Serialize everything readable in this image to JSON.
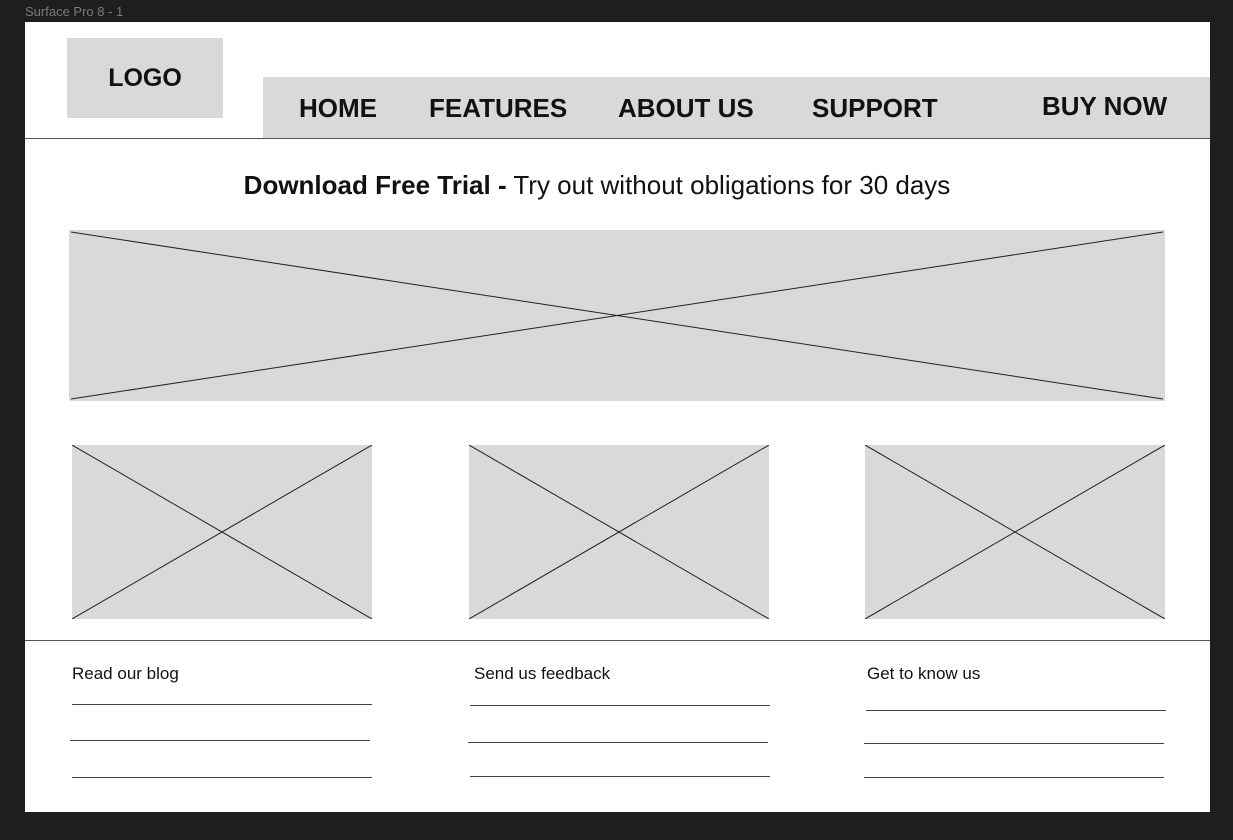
{
  "frame": {
    "label": "Surface Pro 8 - 1"
  },
  "header": {
    "logo_text": "LOGO",
    "nav": {
      "home": "HOME",
      "features": "FEATURES",
      "about_us": "ABOUT US",
      "support": "SUPPORT",
      "buy_now": "BUY NOW"
    }
  },
  "promo": {
    "bold_text": "Download Free Trial -",
    "rest_text": " Try out without obligations for 30 days"
  },
  "footer": {
    "columns": [
      {
        "heading": "Read our blog"
      },
      {
        "heading": "Send us feedback"
      },
      {
        "heading": "Get to know us"
      }
    ]
  },
  "colors": {
    "background": "#1e1e1e",
    "frame": "#ffffff",
    "placeholder": "#d9d9d9"
  }
}
